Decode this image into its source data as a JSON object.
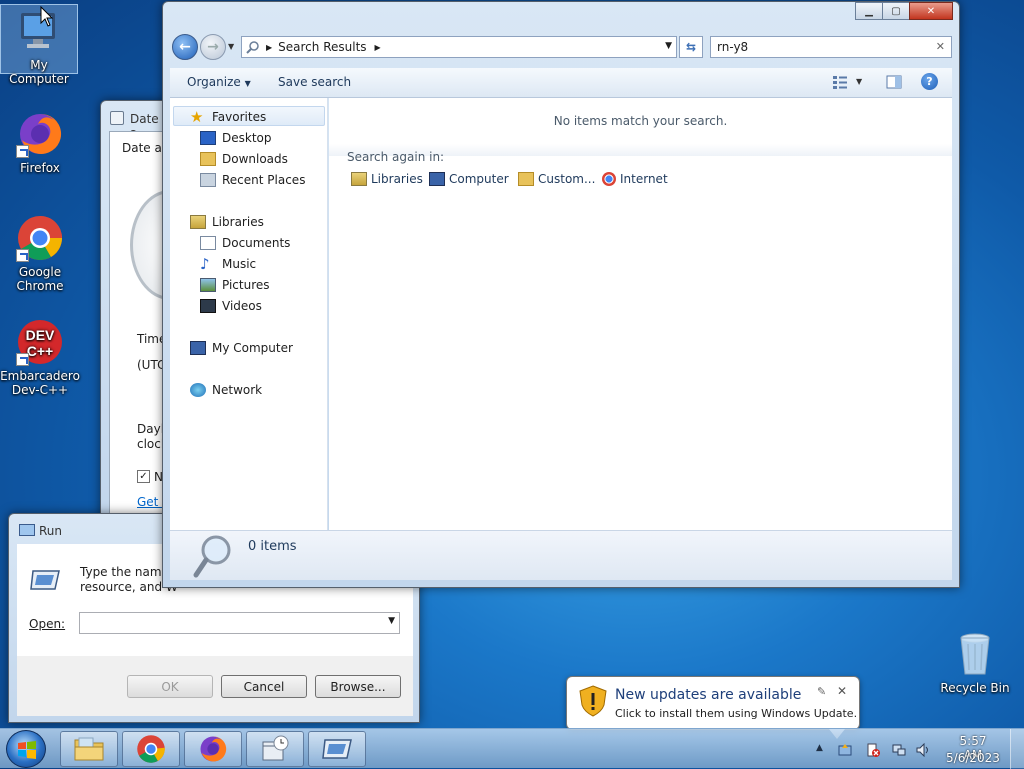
{
  "desktop": {
    "icons": [
      {
        "label": "My Computer"
      },
      {
        "label": "Firefox"
      },
      {
        "label": "Google Chrome"
      },
      {
        "label": "Embarcadero Dev-C++"
      },
      {
        "label": "Recycle Bin"
      }
    ],
    "devcpp_logo_text": "DEV"
  },
  "datetime_window": {
    "title": "Date a",
    "tab": "Date an",
    "time_zone_label": "Time",
    "time_zone_value": "(UTC",
    "daylight_line1": "Dayli",
    "daylight_line2": "clock",
    "notify_checkbox_label": "N",
    "link": "Get n"
  },
  "explorer": {
    "breadcrumb": "Search Results",
    "search_value": "rn-y8",
    "toolbar": {
      "organize": "Organize",
      "save_search": "Save search"
    },
    "nav": {
      "favorites": "Favorites",
      "desktop": "Desktop",
      "downloads": "Downloads",
      "recent_places": "Recent Places",
      "libraries": "Libraries",
      "documents": "Documents",
      "music": "Music",
      "pictures": "Pictures",
      "videos": "Videos",
      "my_computer": "My Computer",
      "network": "Network"
    },
    "empty_message": "No items match your search.",
    "search_again": "Search again in:",
    "search_locations": [
      "Libraries",
      "Computer",
      "Custom...",
      "Internet"
    ],
    "status": "0 items"
  },
  "run_dialog": {
    "title": "Run",
    "description_line1": "Type the name",
    "description_line2": "resource, and W",
    "open_label": "Open:",
    "open_value": "",
    "ok": "OK",
    "cancel": "Cancel",
    "browse": "Browse..."
  },
  "notification": {
    "title": "New updates are available",
    "body": "Click to install them using Windows Update."
  },
  "taskbar": {
    "time": "5:57 AM",
    "date": "5/6/2023"
  },
  "colors": {
    "accent": "#1e395b",
    "link": "#0066cc",
    "close_red": "#c2351f"
  }
}
